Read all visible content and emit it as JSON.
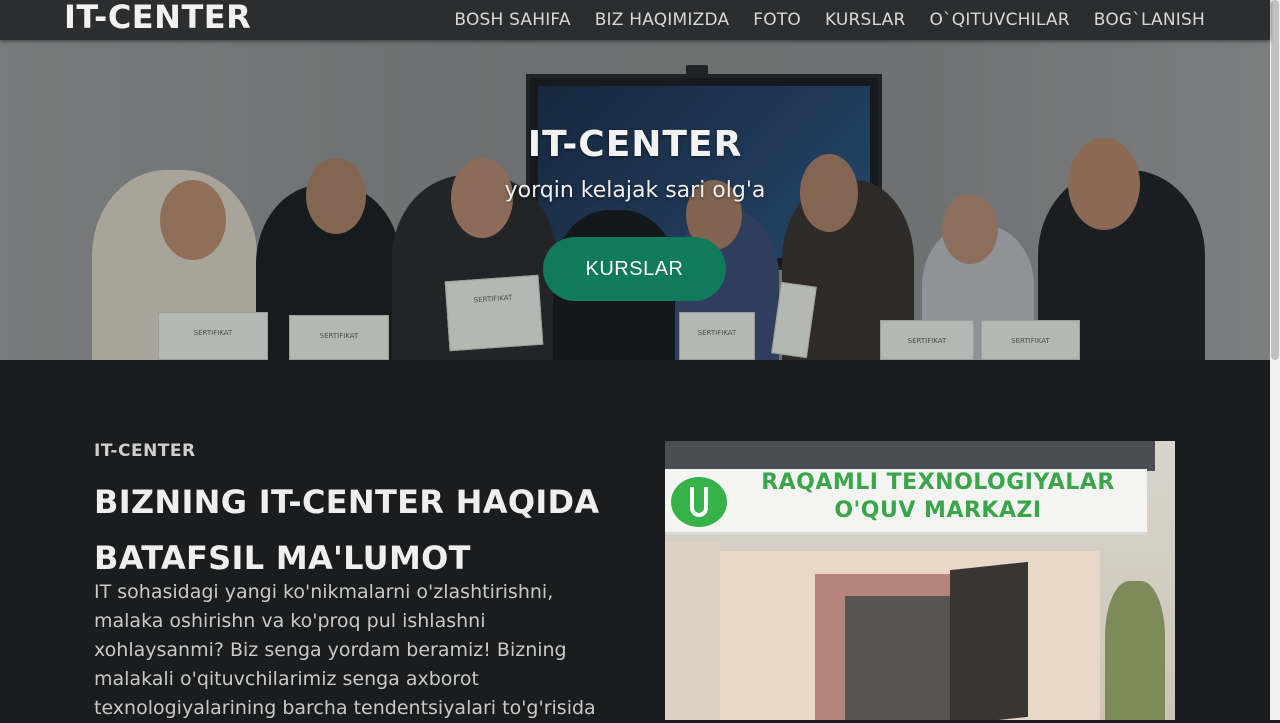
{
  "nav": {
    "brand": "IT-CENTER",
    "links": [
      "BOSH SAHIFA",
      "BIZ HAQIMIZDA",
      "FOTO",
      "KURSLAR",
      "O`QITUVCHILAR",
      "BOG`LANISH"
    ]
  },
  "hero": {
    "title": "IT-CENTER",
    "subtitle": "yorqin kelajak sari olg'a",
    "button_label": "KURSLAR",
    "certificate_text": "SERTIFIKAT"
  },
  "about": {
    "kicker": "IT-CENTER",
    "heading": "BIZNING IT-CENTER HAQIDA BATAFSIL MA'LUMOT",
    "text": "IT sohasidagi yangi ko'nikmalarni o'zlashtirishni, malaka oshirishn va ko'proq pul ishlashni xohlaysanmi? Biz senga yordam beramiz! Bizning malakali o'qituvchilarimiz senga axborot texnologiyalarining barcha tendentsiyalari to'g'risida",
    "photo_sign_line1": "RAQAMLI TEXNOLOGIYALAR",
    "photo_sign_line2": "O'QUV MARKAZI"
  },
  "colors": {
    "navbar": "#2b2d2e",
    "accent_button": "#0f7a5c",
    "page_background": "#1a1c1d"
  }
}
